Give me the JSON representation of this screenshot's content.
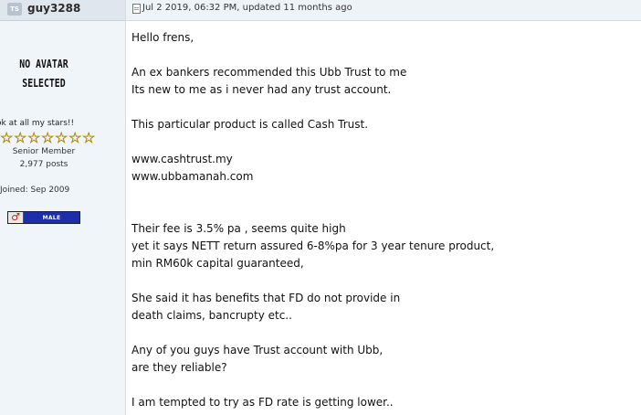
{
  "author": {
    "badge": "TS",
    "username": "guy3288",
    "avatar_line1": "NO AVATAR",
    "avatar_line2": "SELECTED",
    "motto": "ok at all my stars!!",
    "star_count": 7,
    "rank": "Senior Member",
    "posts": "2,977 posts",
    "joined": "Joined: Sep 2009",
    "gender_symbol": "♂",
    "gender_label": "MALE"
  },
  "post": {
    "date": "Jul 2 2019, 06:32 PM, updated 11 months ago",
    "lines": [
      "Hello frens,",
      "",
      "An ex bankers recommended this Ubb Trust to me",
      "Its new to me as i never had any trust account.",
      "",
      "This particular product is called Cash Trust.",
      "",
      "www.cashtrust.my",
      "www.ubbamanah.com",
      "",
      "",
      "Their fee is 3.5% pa , seems quite high",
      "yet it says NETT return assured 6-8%pa for 3 year tenure product,",
      "min RM60k capital guaranteed,",
      "",
      "She said it has benefits that FD do not provide in",
      "death claims, bancrupty etc..",
      "",
      "Any of you guys have Trust account with Ubb,",
      "are they reliable?",
      "",
      "I am tempted to try as FD rate is getting lower.."
    ]
  },
  "colors": {
    "sidebar_bg": "#f0f5fa",
    "header_bg": "#dfe6ee",
    "star": "#f0cf49",
    "gender_bar": "#1d2ea8"
  }
}
